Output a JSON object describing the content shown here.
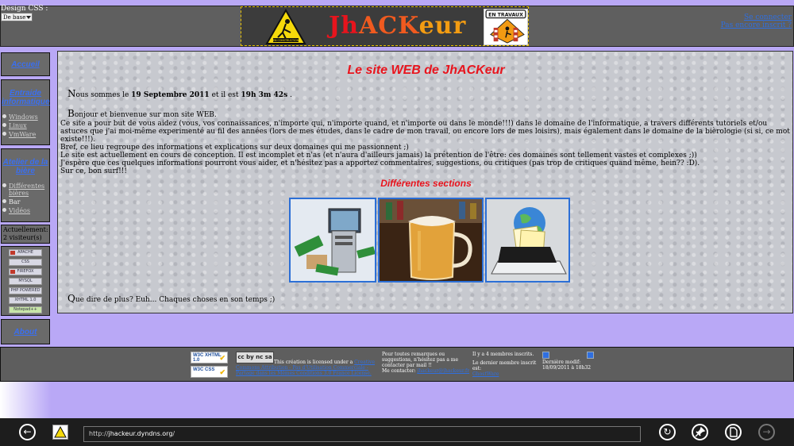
{
  "header": {
    "design_label": "Design CSS :",
    "design_value": "De base",
    "brand": {
      "j": "J",
      "h": "h",
      "ack": "ACK",
      "eur": "eur"
    },
    "sign_left_text": "EN CONSTRUCTION",
    "sign_right_text": "EN TRAVAUX",
    "login": "Se connecter",
    "register": "Pas encore inscrit ?"
  },
  "sidebar": {
    "home": "Accueil",
    "entraide": "Entraide informatique",
    "entraide_items": [
      "Windows",
      "Linux",
      "VmWare"
    ],
    "atelier": "Atelier de la bière",
    "atelier_items": [
      "Différentes bières",
      "Bar",
      "Vidéos"
    ],
    "visitors": "Actuellement: 2 visiteur(s)",
    "badges": [
      "APACHE",
      "CSS",
      "FIREFOX",
      "MYSQL",
      "PHP POWERED",
      "XHTML 1.0",
      "Notepad++"
    ],
    "about": "About"
  },
  "main": {
    "title": "Le site WEB de JhACKeur",
    "date_cap": "N",
    "date_pre": "ous sommes le ",
    "date_value": "19 Septembre 2011",
    "date_mid": " et il est ",
    "time_value": "19h 3m 42s",
    "date_post": " .",
    "hello_cap": "B",
    "hello": "onjour et bienvenue sur mon site WEB.",
    "body": [
      "Ce site a pour but de vous aidez (vous, vos connaissances, n'importe qui, n'importe quand, et n'importe ou dans le monde!!!) dans le domaine de l'informatique, a travers différents tutoriels et/ou astuces que j'ai moi-même experimenté au fil des années (lors de mes études, dans le cadre de mon travail, ou encore lors de mes loisirs), mais également dans le domaine de la bièrologie (si si, ce mot existe!!!).",
      "Bref, ce lieu regroupe des informations et explications sur deux domaines qui me passionnent ;)",
      "Le site est actuellement en cours de conception. Il est incomplet et n'as (et n'aura d'ailleurs jamais) la prétention de l'être: ces domaines sont tellement vastes et complexes ;))",
      "J'espère que ces quelques informations pourront vous aider, et n'hésitez pas a apportez commentaires, suggestions, ou critiques (pas trop de critiques quand même, hein?? :D).",
      "Sur ce, bon surf!!!"
    ],
    "sections_title": "Différentes sections",
    "end_cap": "Q",
    "end": "ue dire de plus? Euh... Chaques choses en son temps ;)"
  },
  "footer": {
    "w3c_xhtml": "W3C XHTML 1.0",
    "w3c_css": "W3C CSS",
    "cc_logo": "cc by nc sa",
    "cc_text": "This création is licensed under a",
    "cc_link": "Creative Commons Attribution - Pas d'Utilisation Commerciale - Partage dans les Mêmes Conditions 3.0 France License.",
    "contact_text": "Pour toutes remarques ou suggestions, n'hésitez pas a me contacter par mail !!",
    "contact_label": "Me contacter:",
    "contact_link": "jhackeur@jhackeur.fr",
    "members_count": "Il y a 4 membres inscrits.",
    "members_last_label": "Le dernier membre inscrit est:",
    "members_last_link": "GhostWare",
    "modif_label": "Dernière modif:",
    "modif_date": "18/09/2011 à 18h32"
  },
  "browser": {
    "url_scheme": "http://",
    "url_host": "jhackeur.dyndns.org",
    "url_path": "/"
  }
}
